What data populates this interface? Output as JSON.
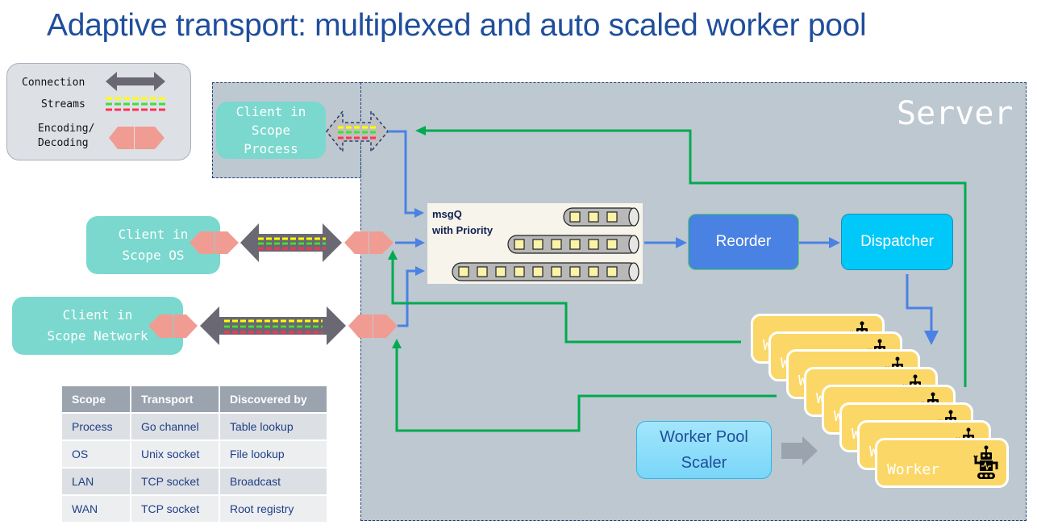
{
  "title": "Adaptive transport: multiplexed and auto scaled worker pool",
  "legend": {
    "connection": "Connection",
    "streams": "Streams",
    "encoding": "Encoding/",
    "decoding": "Decoding"
  },
  "server_label": "Server",
  "clients": [
    {
      "line1": "Client in",
      "line2": "Scope",
      "line3": "Process"
    },
    {
      "line1": "Client in",
      "line2": "Scope OS"
    },
    {
      "line1": "Client in",
      "line2": "Scope Network"
    }
  ],
  "msgq": {
    "line1": "msgQ",
    "line2": "with Priority",
    "queue_lengths": [
      3,
      6,
      9
    ]
  },
  "reorder": "Reorder",
  "dispatcher": "Dispatcher",
  "scaler": {
    "line1": "Worker Pool",
    "line2": "Scaler"
  },
  "worker": {
    "label": "Worker",
    "count": 8
  },
  "colors": {
    "title": "#1f4e9c",
    "server_bg": "#bec8d1",
    "client": "#7ad8ce",
    "codec": "#f19c93",
    "connection": "#6a6872",
    "stream_yellow": "#ffff00",
    "stream_green": "#44dd33",
    "stream_red": "#ff3355",
    "request_arrow": "#4a82e3",
    "response_arrow": "#00aa4f",
    "worker": "#fbd767"
  },
  "table": {
    "headers": [
      "Scope",
      "Transport",
      "Discovered by"
    ],
    "rows": [
      [
        "Process",
        "Go channel",
        "Table lookup"
      ],
      [
        "OS",
        "Unix socket",
        "File lookup"
      ],
      [
        "LAN",
        "TCP socket",
        "Broadcast"
      ],
      [
        "WAN",
        "TCP socket",
        "Root registry"
      ]
    ]
  }
}
